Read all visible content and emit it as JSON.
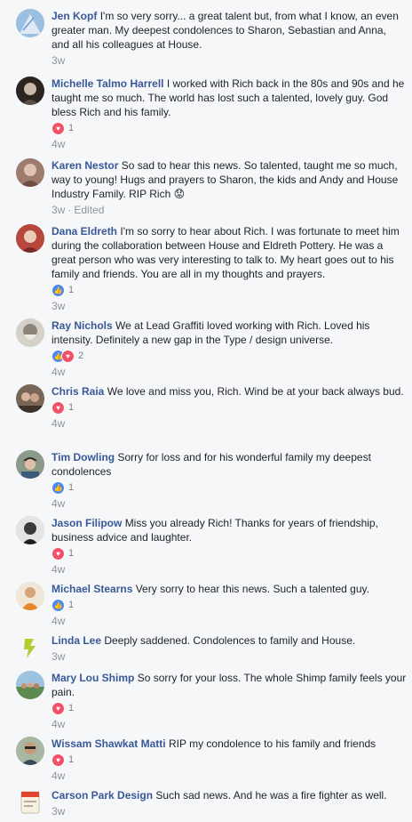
{
  "comments": [
    {
      "author": "Jen Kopf",
      "text": "I'm so very sorry... a great talent but, from what I know, an even greater man. My deepest condolences to Sharon, Sebastian and Anna, and all his colleagues at House.",
      "reaction_count": "",
      "time": "3w",
      "edited": "",
      "avatar_color": "#8fb5d9"
    },
    {
      "author": "Michelle Talmo Harrell",
      "text": "I worked with Rich back in the 80s and 90s and he taught me so much. The world has lost such a talented, lovely guy. God bless Rich and his family.",
      "reaction_count": "1",
      "time": "4w",
      "edited": "",
      "avatar_color": "#3a3330"
    },
    {
      "author": "Karen Nestor",
      "text": "So sad to hear this news. So talented, taught me so much, way to young! Hugs and prayers to Sharon, the kids and Andy and House Industry Family. RIP Rich 😟",
      "reaction_count": "",
      "time": "3w",
      "edited": "Edited",
      "avatar_color": "#a3766a"
    },
    {
      "author": "Dana Eldreth",
      "text": "I'm so sorry to hear about Rich. I was fortunate to meet him during the collaboration between House and Eldreth Pottery. He was a great person who was very interesting to talk to. My heart goes out to his family and friends. You are all in my thoughts and prayers.",
      "reaction_count": "1",
      "time": "3w",
      "edited": "",
      "avatar_color": "#a8362f"
    },
    {
      "author": "Ray Nichols",
      "text": "We at Lead Graffiti loved working with Rich. Loved his intensity. Definitely a new gap in the Type / design universe.",
      "reaction_count": "2",
      "time": "4w",
      "edited": "",
      "avatar_color": "#b9b3a8"
    },
    {
      "author": "Chris Raia",
      "text": "We love and miss you, Rich. Wind be at your back always bud.",
      "reaction_count": "1",
      "time": "4w",
      "edited": "",
      "avatar_color": "#6b5a4c"
    },
    {
      "author": "Tim Dowling",
      "text": "Sorry for loss and for his wonderful family my deepest condolences",
      "reaction_count": "1",
      "time": "4w",
      "edited": "",
      "avatar_color": "#7e8a7d"
    },
    {
      "author": "Jason Filipow",
      "text": "Miss you already Rich! Thanks for years of friendship, business advice and laughter.",
      "reaction_count": "1",
      "time": "4w",
      "edited": "",
      "avatar_color": "#d9d9d9"
    },
    {
      "author": "Michael Stearns",
      "text": "Very sorry to hear this news. Such a talented guy.",
      "reaction_count": "1",
      "time": "4w",
      "edited": "",
      "avatar_color": "#e38a2e"
    },
    {
      "author": "Linda Lee",
      "text": "Deeply saddened. Condolences to family and House.",
      "reaction_count": "",
      "time": "3w",
      "edited": "",
      "avatar_color": "#c7d94a"
    },
    {
      "author": "Mary Lou Shimp",
      "text": "So sorry for your loss. The whole Shimp family feels your pain.",
      "reaction_count": "1",
      "time": "4w",
      "edited": "",
      "avatar_color": "#6b8f5e"
    },
    {
      "author": "Wissam Shawkat Matti",
      "text": "RIP my condolence to his family and friends",
      "reaction_count": "1",
      "time": "4w",
      "edited": "",
      "avatar_color": "#8c6f5a"
    },
    {
      "author": "Carson Park Design",
      "text": "Such sad news. And he was a fire fighter as well.",
      "reaction_count": "",
      "time": "3w",
      "edited": "",
      "avatar_color": "#e8e1d0"
    }
  ],
  "reaction_icons": {
    "heart": "heart-icon",
    "like": "like-icon"
  },
  "colors": {
    "author_link": "#385898",
    "heart": "#f25268",
    "like": "#4a89f3",
    "meta": "#90949c"
  }
}
